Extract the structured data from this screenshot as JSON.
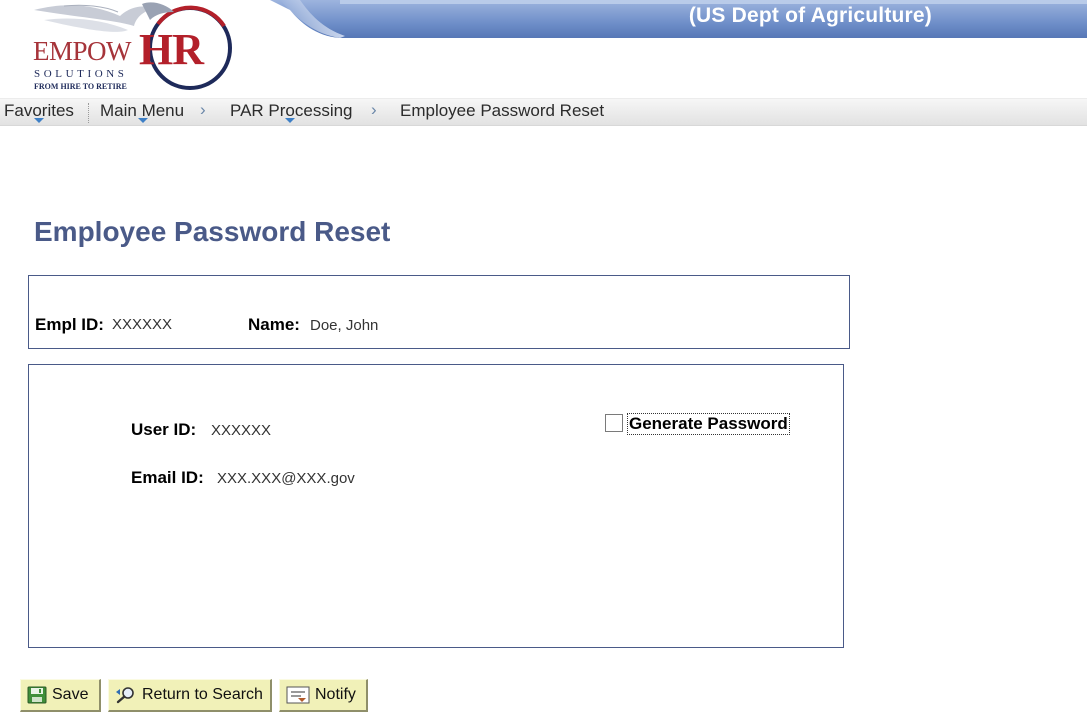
{
  "header": {
    "org_title": "(US Dept of Agriculture)",
    "logo": {
      "empow": "EMPOW",
      "hr": "HR",
      "solutions": "SOLUTIONS",
      "tagline": "FROM HIRE TO RETIRE"
    },
    "colors": {
      "banner_blue": "#6f8fc9",
      "logo_red": "#b3202a",
      "logo_navy": "#1e2a5a"
    }
  },
  "nav": {
    "favorites": "Favorites",
    "main_menu": "Main Menu",
    "par_processing": "PAR Processing",
    "current": "Employee Password Reset"
  },
  "page": {
    "title": "Employee Password Reset",
    "title_color": "#4a5a88"
  },
  "employee": {
    "empl_id_label": "Empl ID:",
    "empl_id_value": "XXXXXX",
    "name_label": "Name:",
    "name_value": "Doe, John"
  },
  "details": {
    "user_id_label": "User ID:",
    "user_id_value": "XXXXXX",
    "email_id_label": "Email ID:",
    "email_id_value": "XXX.XXX@XXX.gov",
    "generate_password_label": "Generate Password",
    "generate_password_checked": false
  },
  "buttons": {
    "save": "Save",
    "return_to_search": "Return to Search",
    "notify": "Notify",
    "button_color": "#f1f1b8"
  }
}
